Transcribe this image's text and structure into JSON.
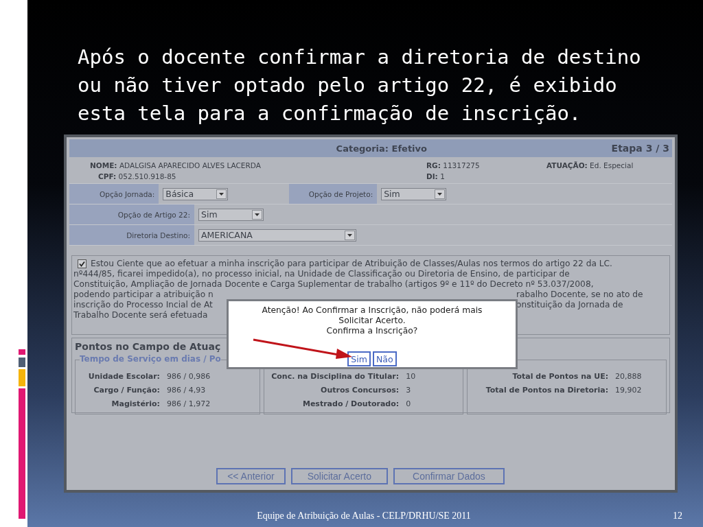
{
  "slide": {
    "title": "Após o docente confirmar a diretoria de destino ou não tiver optado pelo artigo 22, é exibido esta tela para a confirmação de inscrição.",
    "footer": "Equipe de Atribuição de Aulas - CELP/DRHU/SE  2011",
    "page_number": "12"
  },
  "form": {
    "header": {
      "category": "Categoria: Efetivo",
      "step": "Etapa 3 / 3"
    },
    "info_rows": [
      [
        {
          "label": "NOME:",
          "value": "ADALGISA APARECIDO ALVES LACERDA"
        },
        {
          "label": "RG:",
          "value": "11317275"
        },
        {
          "label": "ATUAÇÃO:",
          "value": "Ed. Especial"
        }
      ],
      [
        {
          "label": "CPF:",
          "value": "052.510.918-85"
        },
        {
          "label": "DI:",
          "value": "1"
        }
      ]
    ],
    "field_rows": [
      [
        {
          "label": "Opção Jornada:",
          "value": "Básica",
          "kind": "short"
        },
        {
          "label": "Opção de Projeto:",
          "value": "Sim",
          "kind": "short"
        }
      ],
      [
        {
          "label": "Opção de Artigo 22:",
          "value": "Sim",
          "kind": "short"
        }
      ],
      [
        {
          "label": "Diretoria Destino:",
          "value": "AMERICANA",
          "kind": "wide"
        }
      ]
    ],
    "agreement": {
      "checked": true,
      "lines": [
        {
          "left": "Estou Ciente que ao efetuar a minha inscrição para participar de Atribuição de Classes/Aulas nos termos do artigo 22 da LC."
        },
        {
          "left": "nº444/85, ficarei impedido(a), no processo inicial, na Unidade de Classificação ou Diretoria de Ensino, de participar de"
        },
        {
          "left": "Constituição, Ampliação de Jornada Docente e Carga Suplementar de trabalho (artigos 9º e 11º do Decreto nº 53.037/2008,"
        },
        {
          "left": "podendo participar a atribuição n",
          "right": "rabalho Docente, se no ato de"
        },
        {
          "left": "inscrição do Processo Incial de At",
          "right": "onstituição da Jornada de"
        },
        {
          "left": "Trabalho Docente será efetuada"
        }
      ]
    },
    "points": {
      "legend": "Pontos no Campo de Atuaç",
      "sublegend": "Tempo de Serviço em dias / Po",
      "columns": [
        [
          {
            "label": "Unidade Escolar:",
            "value": "986 / 0,986"
          },
          {
            "label": "Cargo / Função:",
            "value": "986 / 4,93"
          },
          {
            "label": "Magistério:",
            "value": "986 / 1,972"
          }
        ],
        [
          {
            "label": "Conc. na Disciplina do Titular:",
            "value": "10"
          },
          {
            "label": "Outros Concursos:",
            "value": "3"
          },
          {
            "label": "Mestrado / Doutorado:",
            "value": "0"
          }
        ],
        [
          {
            "label": "Total de Pontos na UE:",
            "value": "20,888"
          },
          {
            "label": "Total de Pontos na Diretoria:",
            "value": "19,902"
          }
        ]
      ]
    },
    "buttons": [
      "<< Anterior",
      "Solicitar Acerto",
      "Confirmar Dados"
    ],
    "dialog": {
      "message_lines": [
        "Atenção! Ao Confirmar a Inscrição, não poderá mais",
        "Solicitar Acerto.",
        "Confirma a Inscrição?"
      ],
      "buttons": [
        "Sim",
        "Não"
      ]
    }
  }
}
